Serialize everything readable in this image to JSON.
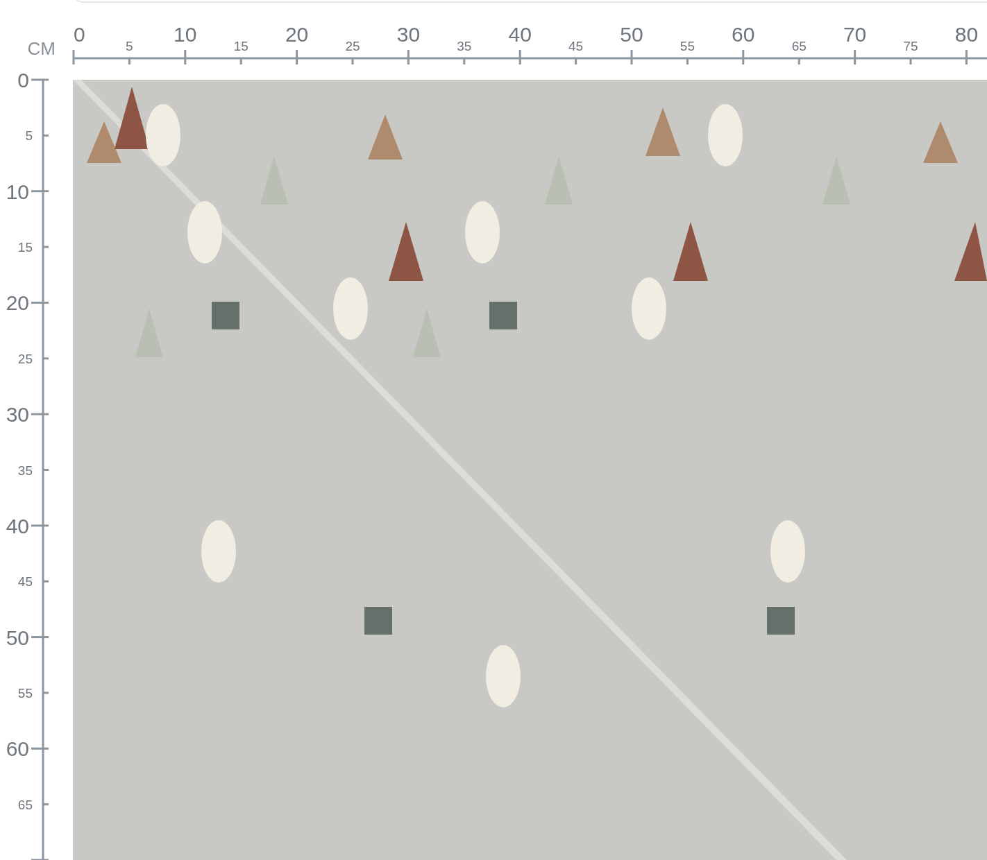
{
  "unit": "CM",
  "horizontal_ruler": {
    "ticks": [
      {
        "label": "0",
        "kind": "major"
      },
      {
        "label": "5",
        "kind": "minor"
      },
      {
        "label": "10",
        "kind": "major"
      },
      {
        "label": "15",
        "kind": "minor"
      },
      {
        "label": "20",
        "kind": "major"
      },
      {
        "label": "25",
        "kind": "minor"
      },
      {
        "label": "30",
        "kind": "major"
      },
      {
        "label": "35",
        "kind": "minor"
      },
      {
        "label": "40",
        "kind": "major"
      },
      {
        "label": "45",
        "kind": "minor"
      },
      {
        "label": "50",
        "kind": "major"
      },
      {
        "label": "55",
        "kind": "minor"
      },
      {
        "label": "60",
        "kind": "major"
      },
      {
        "label": "65",
        "kind": "minor"
      },
      {
        "label": "70",
        "kind": "major"
      },
      {
        "label": "75",
        "kind": "minor"
      },
      {
        "label": "80",
        "kind": "major"
      }
    ]
  },
  "vertical_ruler": {
    "ticks": [
      {
        "label": "0",
        "kind": "major"
      },
      {
        "label": "5",
        "kind": "minor"
      },
      {
        "label": "10",
        "kind": "major"
      },
      {
        "label": "15",
        "kind": "minor"
      },
      {
        "label": "20",
        "kind": "major"
      },
      {
        "label": "25",
        "kind": "minor"
      },
      {
        "label": "30",
        "kind": "major"
      },
      {
        "label": "35",
        "kind": "minor"
      },
      {
        "label": "40",
        "kind": "major"
      },
      {
        "label": "45",
        "kind": "minor"
      },
      {
        "label": "50",
        "kind": "major"
      },
      {
        "label": "55",
        "kind": "minor"
      },
      {
        "label": "60",
        "kind": "major"
      },
      {
        "label": "65",
        "kind": "minor"
      },
      {
        "kind": "major"
      }
    ]
  }
}
